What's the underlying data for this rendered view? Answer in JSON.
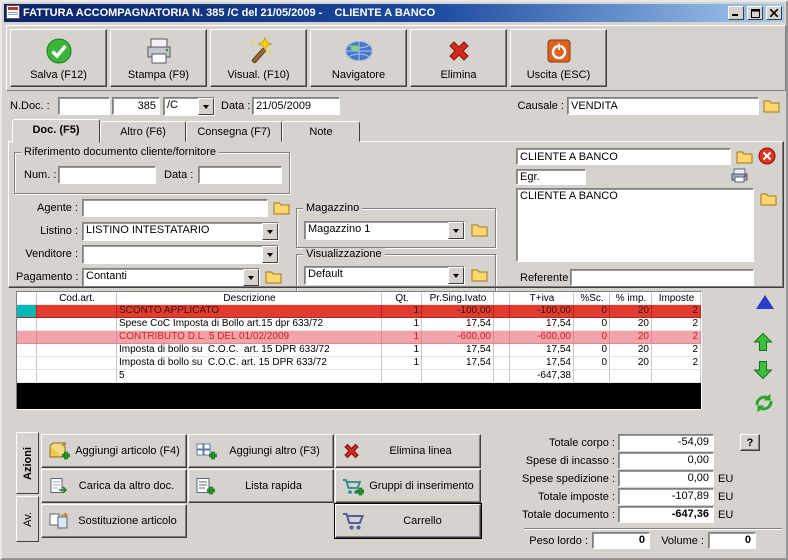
{
  "window": {
    "title": "FATTURA ACCOMPAGNATORIA N. 385 /C del 21/05/2009 -    CLIENTE A BANCO"
  },
  "toolbar": {
    "salva": "Salva (F12)",
    "stampa": "Stampa (F9)",
    "visual": "Visual. (F10)",
    "navigatore": "Navigatore",
    "elimina": "Elimina",
    "uscita": "Uscita (ESC)"
  },
  "doc_header": {
    "ndoc_label": "N.Doc. :",
    "ndoc_extra": "",
    "ndoc_value": "385",
    "series_value": "/C",
    "data_label": "Data :",
    "data_value": "21/05/2009",
    "causale_label": "Causale :",
    "causale_value": "VENDITA"
  },
  "tabs": {
    "doc": "Doc. (F5)",
    "altro": "Altro (F6)",
    "consegna": "Consegna (F7)",
    "note": "Note"
  },
  "form": {
    "rif_title": "Riferimento documento cliente/fornitore",
    "num_label": "Num. :",
    "num_value": "",
    "rif_data_label": "Data :",
    "rif_data_value": "",
    "agente_label": "Agente :",
    "agente_value": "",
    "listino_label": "Listino :",
    "listino_value": "LISTINO INTESTATARIO",
    "venditore_label": "Venditore :",
    "venditore_value": "",
    "pagamento_label": "Pagamento :",
    "pagamento_value": "Contanti",
    "magazzino_title": "Magazzino",
    "magazzino_value": "Magazzino 1",
    "visualizzazione_title": "Visualizzazione",
    "visualizzazione_value": "Default",
    "cliente_value": "CLIENTE A BANCO",
    "egr_value": "Egr.",
    "indirizzo_value": "CLIENTE A BANCO",
    "referente_label": "Referente",
    "referente_value": ""
  },
  "table": {
    "columns": [
      "",
      "Cod.art.",
      "Descrizione",
      "Qt.",
      "Pr.Sing.Ivato",
      "",
      "T+iva",
      "%Sc.",
      "% imp.",
      "Imposte"
    ],
    "rows": [
      {
        "cod": "",
        "desc": "SCONTO APPLICATO",
        "qt": "1",
        "pr": "-100,00",
        "tiva": "-100,00",
        "sc": "0",
        "aliq": "20",
        "imposte": "2"
      },
      {
        "cod": "",
        "desc": "Spese CoC Imposta di Bollo art.15 dpr 633/72",
        "qt": "1",
        "pr": "17,54",
        "tiva": "17,54",
        "sc": "0",
        "aliq": "20",
        "imposte": "2"
      },
      {
        "cod": "",
        "desc": "CONTRIBUTO D.L. 5 DEL 01/02/2009",
        "qt": "1",
        "pr": "-600,00",
        "tiva": "-600,00",
        "sc": "0",
        "aliq": "20",
        "imposte": "2"
      },
      {
        "cod": "",
        "desc": "Imposta di bollo su  C.O.C.  art. 15 DPR 633/72",
        "qt": "1",
        "pr": "17,54",
        "tiva": "17,54",
        "sc": "0",
        "aliq": "20",
        "imposte": "2"
      },
      {
        "cod": "",
        "desc": "Imposta di bollo su  C.O.C. art. 15 DPR 633/72",
        "qt": "1",
        "pr": "17,54",
        "tiva": "17,54",
        "sc": "0",
        "aliq": "20",
        "imposte": "2"
      }
    ],
    "summary": {
      "count": "5",
      "total": "-647,38"
    }
  },
  "actions": {
    "tab_azioni": "Azioni",
    "tab_av": "Av.",
    "aggiungi_articolo": "Aggiungi articolo (F4)",
    "aggiungi_altro": "Aggiungi altro (F3)",
    "elimina_linea": "Elimina linea",
    "carica_altro_doc": "Carica da altro doc.",
    "lista_rapida": "Lista rapida",
    "gruppi_inserimento": "Gruppi di inserimento",
    "sostituzione_articolo": "Sostituzione articolo",
    "carrello": "Carrello"
  },
  "totals": {
    "totale_corpo_label": "Totale corpo :",
    "totale_corpo": "-54,09",
    "help_button": "?",
    "spese_incasso_label": "Spese di incasso :",
    "spese_incasso": "0,00",
    "spese_spedizione_label": "Spese spedizione :",
    "spese_spedizione": "0,00",
    "totale_imposte_label": "Totale imposte :",
    "totale_imposte": "-107,89",
    "totale_documento_label": "Totale documento :",
    "totale_documento": "-647,36",
    "currency": "EU",
    "peso_lordo_label": "Peso lordo :",
    "peso_lordo": "0",
    "volume_label": "Volume :",
    "volume": "0"
  },
  "colors": {
    "titlebar_start": "#0a246a",
    "titlebar_end": "#a6caf0",
    "selected_row": "#e13c30",
    "contributo_row": "#f2a4aa",
    "row_marker": "#00b8b8",
    "face": "#d6d3ce"
  }
}
